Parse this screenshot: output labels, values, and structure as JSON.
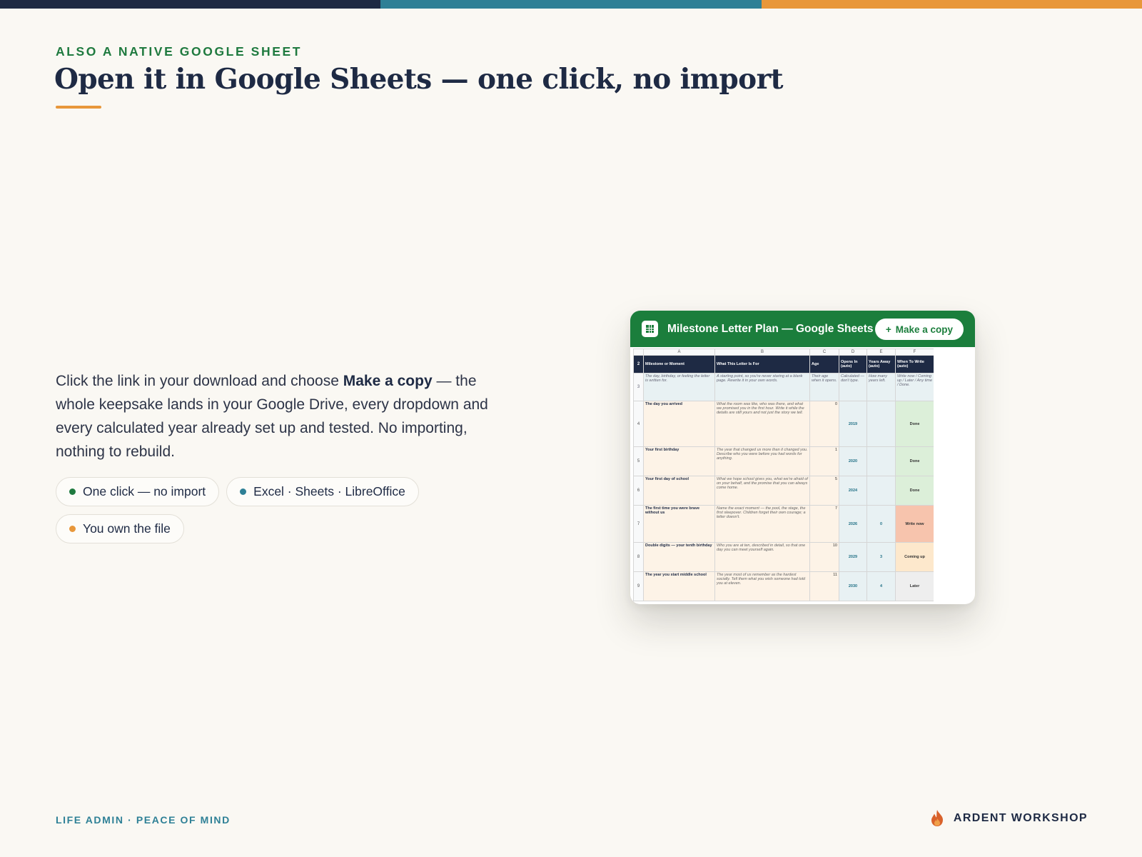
{
  "colors": {
    "navy": "#1e2a44",
    "teal": "#2e8096",
    "orange": "#e8973a",
    "green": "#1b7e3c",
    "background": "#faf8f3",
    "status_done": "#dcefd9",
    "status_write_now": "#f7c4ad",
    "status_coming_up": "#fde8cc",
    "status_later": "#eeeeee"
  },
  "header": {
    "eyebrow": "ALSO A NATIVE GOOGLE SHEET",
    "title": "Open it in Google Sheets — one click, no import"
  },
  "body": {
    "text_before": "Click the link in your download and choose ",
    "text_bold": "Make a copy",
    "text_after": " — the whole keepsake lands in your Google Drive, every dropdown and every calculated year already set up and tested. No importing, nothing to rebuild."
  },
  "chips": [
    {
      "label": "One click — no import",
      "dot_color": "#1f7a3f"
    },
    {
      "label": "Excel · Sheets · LibreOffice",
      "dot_color": "#2e8096"
    },
    {
      "label": "You own the file",
      "dot_color": "#e8973a"
    }
  ],
  "sheet_window": {
    "title": "Milestone Letter Plan — Google Sheets",
    "copy_plus": "+",
    "copy_label": "Make a copy",
    "logo_icon": "sheets-grid-icon"
  },
  "spreadsheet": {
    "column_letters": [
      "A",
      "B",
      "C",
      "D",
      "E",
      "F"
    ],
    "header_row_number": "2",
    "headers": [
      "Milestone or Moment",
      "What This Letter Is For",
      "Age",
      "Opens In (auto)",
      "Years Away (auto)",
      "When To Write (auto)"
    ],
    "hint_row_number": "3",
    "hints": [
      "The day, birthday, or feeling the letter is written for.",
      "A starting point, so you're never staring at a blank page. Rewrite it in your own words.",
      "Their age when it opens.",
      "Calculated — don't type.",
      "How many years left.",
      "Write now / Coming up / Later / Any time / Done."
    ],
    "rows": [
      {
        "n": "4",
        "milestone": "The day you arrived",
        "what": "What the room was like, who was there, and what we promised you in the first hour. Write it while the details are still yours and not just the story we tell.",
        "age": "0",
        "opens": "2019",
        "away": "",
        "when": "Done",
        "status": "done"
      },
      {
        "n": "5",
        "milestone": "Your first birthday",
        "what": "The year that changed us more than it changed you. Describe who you were before you had words for anything.",
        "age": "1",
        "opens": "2020",
        "away": "",
        "when": "Done",
        "status": "done"
      },
      {
        "n": "6",
        "milestone": "Your first day of school",
        "what": "What we hope school gives you, what we're afraid of on your behalf, and the promise that you can always come home.",
        "age": "5",
        "opens": "2024",
        "away": "",
        "when": "Done",
        "status": "done"
      },
      {
        "n": "7",
        "milestone": "The first time you were brave without us",
        "what": "Name the exact moment — the pool, the stage, the first sleepover. Children forget their own courage; a letter doesn't.",
        "age": "7",
        "opens": "2026",
        "away": "0",
        "when": "Write now",
        "status": "write_now"
      },
      {
        "n": "8",
        "milestone": "Double digits — your tenth birthday",
        "what": "Who you are at ten, described in detail, so that one day you can meet yourself again.",
        "age": "10",
        "opens": "2029",
        "away": "3",
        "when": "Coming up",
        "status": "coming_up"
      },
      {
        "n": "9",
        "milestone": "The year you start middle school",
        "what": "The year most of us remember as the hardest socially. Tell them what you wish someone had told you at eleven.",
        "age": "11",
        "opens": "2030",
        "away": "4",
        "when": "Later",
        "status": "later"
      }
    ]
  },
  "footer": {
    "left": "LIFE ADMIN · PEACE OF MIND",
    "brand": "ARDENT WORKSHOP",
    "brand_icon": "flame-icon"
  }
}
